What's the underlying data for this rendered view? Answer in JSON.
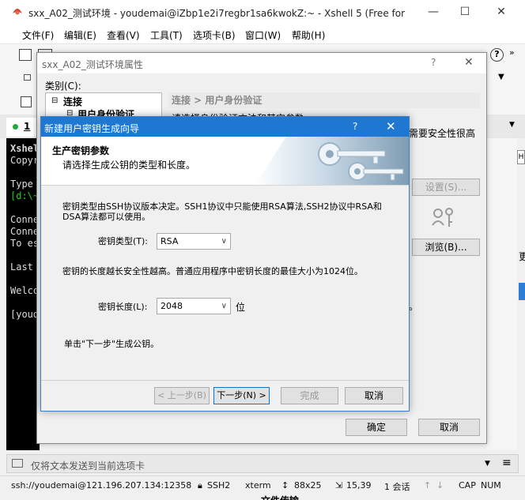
{
  "main": {
    "title": "sxx_A02_测试环境 - youdemai@iZbp1e2i7regbr1sa6kwokZ:~ - Xshell 5 (Free for",
    "menu": [
      "文件(F)",
      "编辑(E)",
      "查看(V)",
      "工具(T)",
      "选项卡(B)",
      "窗口(W)",
      "帮助(H)"
    ],
    "tab_label": "1",
    "terminal_lines": [
      "Xshel",
      "Copyr",
      "",
      "Type ",
      "[d:\\~",
      "",
      "Conne",
      "Conne",
      "To es",
      "",
      "Last ",
      "",
      "Welco",
      "",
      "[youd"
    ],
    "right_fragments": {
      "need_security": "需要安全性很高",
      "more": "更"
    },
    "send_text": "仅将文本发送到当前选项卡",
    "status": {
      "connection": "ssh://youdemai@121.196.207.134:12358",
      "protocol": "SSH2",
      "term": "xterm",
      "size": "88x25",
      "cursor": "15,39",
      "sessions": "1 会话",
      "cap": "CAP",
      "num": "NUM"
    },
    "bottom_fragment": "文件传输"
  },
  "props": {
    "title": "sxx_A02_测试环境属性",
    "category_label": "类别(C):",
    "tree": [
      "连接",
      "用户身份验证"
    ],
    "header": "连接 > 用户身份验证",
    "partial_text": "请选择身份验证方法和其它参数",
    "setup_button": "设置(S)...",
    "browse_button": "浏览(B)...",
    "ok_button": "确定",
    "cancel_button": "取消",
    "period": "。"
  },
  "wizard": {
    "title": "新建用户密钥生成向导",
    "help": "?",
    "heading": "生产密钥参数",
    "subheading": "请选择生成公钥的类型和长度。",
    "desc_type_1": "密钥类型由SSH协议版本决定。SSH1协议中只能使用RSA算法,SSH2协议中RSA和",
    "desc_type_2": "DSA算法都可以使用。",
    "key_type_label": "密钥类型(T):",
    "key_type_value": "RSA",
    "desc_length": "密钥的长度越长安全性越高。普通应用程序中密钥长度的最佳大小为1024位。",
    "key_length_label": "密钥长度(L):",
    "key_length_value": "2048",
    "unit": "位",
    "next_hint": "单击\"下一步\"生成公钥。",
    "buttons": {
      "prev": "< 上一步(B)",
      "next": "下一步(N) >",
      "finish": "完成",
      "cancel": "取消"
    }
  }
}
